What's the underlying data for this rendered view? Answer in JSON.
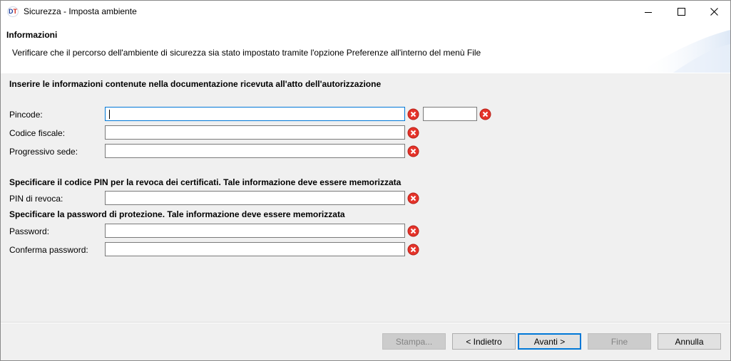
{
  "window": {
    "title": "Sicurezza - Imposta ambiente",
    "icon_letters": {
      "d": "D",
      "t": "T"
    },
    "controls": [
      "minimize-icon",
      "maximize-icon",
      "close-icon"
    ]
  },
  "header": {
    "title": "Informazioni",
    "description": "Verificare che il percorso dell'ambiente di sicurezza sia stato impostato tramite l'opzione Preferenze all'interno del menù File"
  },
  "sections": {
    "authorization": "Inserire le informazioni contenute nella documentazione ricevuta all'atto dell'autorizzazione",
    "revocation": "Specificare il codice PIN per la revoca dei certificati. Tale informazione deve essere memorizzata",
    "protection": "Specificare la password di protezione. Tale informazione deve essere memorizzata"
  },
  "fields": {
    "pincode": {
      "label": "Pincode:",
      "value": "",
      "extra_value": ""
    },
    "codice_fiscale": {
      "label": "Codice fiscale:",
      "value": ""
    },
    "progressivo_sede": {
      "label": "Progressivo sede:",
      "value": ""
    },
    "pin_revoca": {
      "label": "PIN di revoca:",
      "value": ""
    },
    "password": {
      "label": "Password:",
      "value": ""
    },
    "conferma_password": {
      "label": "Conferma password:",
      "value": ""
    }
  },
  "buttons": {
    "stampa": "Stampa...",
    "indietro": "< Indietro",
    "avanti": "Avanti >",
    "fine": "Fine",
    "annulla": "Annulla"
  },
  "colors": {
    "error_icon": "#e5332a",
    "focus_border": "#0078d7",
    "logo_blue": "#1d3f9e",
    "logo_red": "#d2261b"
  }
}
